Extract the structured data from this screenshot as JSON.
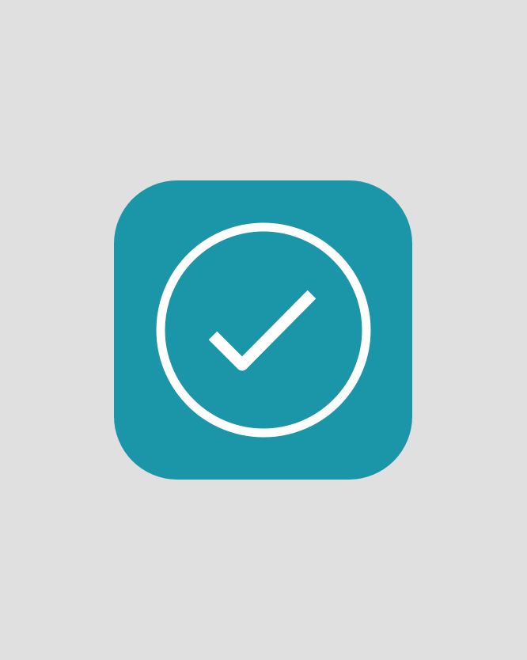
{
  "colors": {
    "background": "#e0e0e0",
    "icon_tile": "#1b95a8",
    "glyph": "#ffffff"
  },
  "icon": {
    "name": "check-circle-icon"
  }
}
